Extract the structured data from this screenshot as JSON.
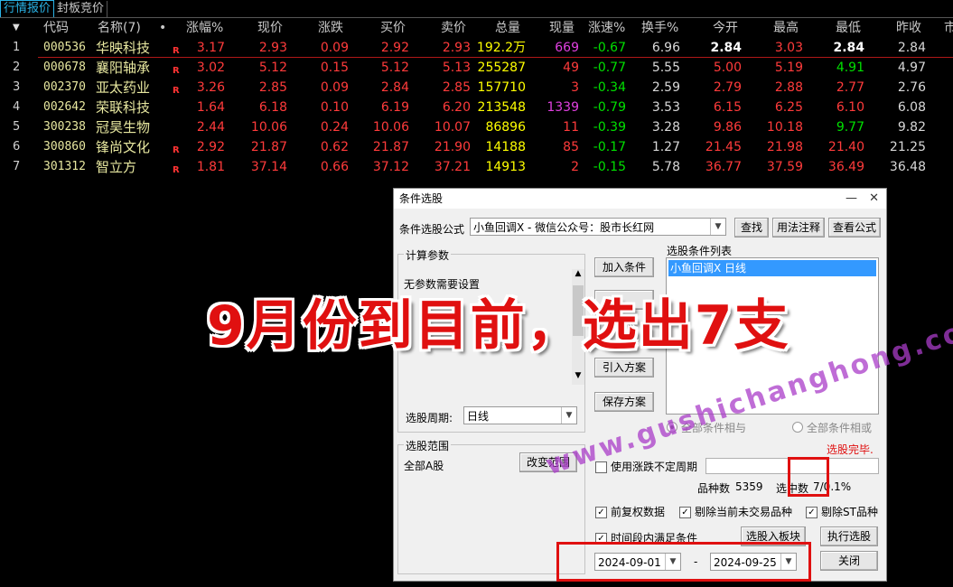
{
  "tabs": [
    {
      "label": "行情报价"
    },
    {
      "label": "封板竞价"
    }
  ],
  "table": {
    "headers": {
      "code": "代码",
      "name": "名称(7)",
      "dot": "•",
      "chg_pct": "涨幅%",
      "price": "现价",
      "chg": "涨跌",
      "bid": "买价",
      "ask": "卖价",
      "volume": "总量",
      "cur_vol": "现量",
      "speed": "涨速%",
      "turnover": "换手%",
      "open": "今开",
      "high": "最高",
      "low": "最低",
      "prev_close": "昨收",
      "extra": "市"
    },
    "rows": [
      {
        "idx": "1",
        "code": "000536",
        "name": "华映科技",
        "tag": "R",
        "chg_pct": "3.17",
        "price": "2.93",
        "chg": "0.09",
        "bid": "2.92",
        "ask": "2.93",
        "volume": "192.2万",
        "cur_vol": "669",
        "speed": "-0.67",
        "turnover": "6.96",
        "open": "2.84",
        "high": "3.03",
        "low": "2.84",
        "prev_close": "2.84"
      },
      {
        "idx": "2",
        "code": "000678",
        "name": "襄阳轴承",
        "tag": "R",
        "chg_pct": "3.02",
        "price": "5.12",
        "chg": "0.15",
        "bid": "5.12",
        "ask": "5.13",
        "volume": "255287",
        "cur_vol": "49",
        "speed": "-0.77",
        "turnover": "5.55",
        "open": "5.00",
        "high": "5.19",
        "low": "4.91",
        "prev_close": "4.97"
      },
      {
        "idx": "3",
        "code": "002370",
        "name": "亚太药业",
        "tag": "R",
        "chg_pct": "3.26",
        "price": "2.85",
        "chg": "0.09",
        "bid": "2.84",
        "ask": "2.85",
        "volume": "157710",
        "cur_vol": "3",
        "speed": "-0.34",
        "turnover": "2.59",
        "open": "2.79",
        "high": "2.88",
        "low": "2.77",
        "prev_close": "2.76"
      },
      {
        "idx": "4",
        "code": "002642",
        "name": "荣联科技",
        "tag": "",
        "chg_pct": "1.64",
        "price": "6.18",
        "chg": "0.10",
        "bid": "6.19",
        "ask": "6.20",
        "volume": "213548",
        "cur_vol": "1339",
        "speed": "-0.79",
        "turnover": "3.53",
        "open": "6.15",
        "high": "6.25",
        "low": "6.10",
        "prev_close": "6.08"
      },
      {
        "idx": "5",
        "code": "300238",
        "name": "冠昊生物",
        "tag": "",
        "chg_pct": "2.44",
        "price": "10.06",
        "chg": "0.24",
        "bid": "10.06",
        "ask": "10.07",
        "volume": "86896",
        "cur_vol": "11",
        "speed": "-0.39",
        "turnover": "3.28",
        "open": "9.86",
        "high": "10.18",
        "low": "9.77",
        "prev_close": "9.82"
      },
      {
        "idx": "6",
        "code": "300860",
        "name": "锋尚文化",
        "tag": "R",
        "chg_pct": "2.92",
        "price": "21.87",
        "chg": "0.62",
        "bid": "21.87",
        "ask": "21.90",
        "volume": "14188",
        "cur_vol": "85",
        "speed": "-0.17",
        "turnover": "1.27",
        "open": "21.45",
        "high": "21.98",
        "low": "21.40",
        "prev_close": "21.25"
      },
      {
        "idx": "7",
        "code": "301312",
        "name": "智立方",
        "tag": "R",
        "chg_pct": "1.81",
        "price": "37.14",
        "chg": "0.66",
        "bid": "37.12",
        "ask": "37.21",
        "volume": "14913",
        "cur_vol": "2",
        "speed": "-0.15",
        "turnover": "5.78",
        "open": "36.77",
        "high": "37.59",
        "low": "36.49",
        "prev_close": "36.48"
      }
    ]
  },
  "dialog": {
    "title": "条件选股",
    "formula_label": "条件选股公式",
    "formula_value": "小鱼回调X  -  微信公众号：股市长红网",
    "find_btn": "查找",
    "usage_btn": "用法注释",
    "view_btn": "查看公式",
    "params_group": "计算参数",
    "params_text": "无参数需要设置",
    "add_btn": "加入条件",
    "import_btn": "引入方案",
    "save_btn": "保存方案",
    "cond_list_label": "选股条件列表",
    "cond_item": "小鱼回调X  日线",
    "period_label": "选股周期:",
    "period_value": "日线",
    "radio_and": "全部条件相与",
    "radio_or": "全部条件相或",
    "done_text": "选股完毕.",
    "range_group": "选股范围",
    "range_value": "全部A股",
    "change_range_btn": "改变范围",
    "use_period_label": "使用涨跌不定周期",
    "count_label": "品种数",
    "count_value": "5359",
    "selected_label": "选中数",
    "selected_value": "7/0.1%",
    "prev_adj_label": "前复权数据",
    "exclude_nontrade_label": "剔除当前未交易品种",
    "exclude_st_label": "剔除ST品种",
    "time_range_label": "时间段内满足条件",
    "to_block_btn": "选股入板块",
    "run_btn": "执行选股",
    "date_from": "2024-09-01",
    "date_sep": "-",
    "date_to": "2024-09-25",
    "close_btn": "关闭"
  },
  "overlay": {
    "caption": "9月份到目前，选出7支",
    "watermark": "www.gushichanghong.com"
  },
  "colors": {
    "up": "#ff3b3b",
    "down": "#00e000",
    "accent_tab": "#2ab3e6",
    "caption": "#e01010",
    "selection": "#3399ff"
  }
}
